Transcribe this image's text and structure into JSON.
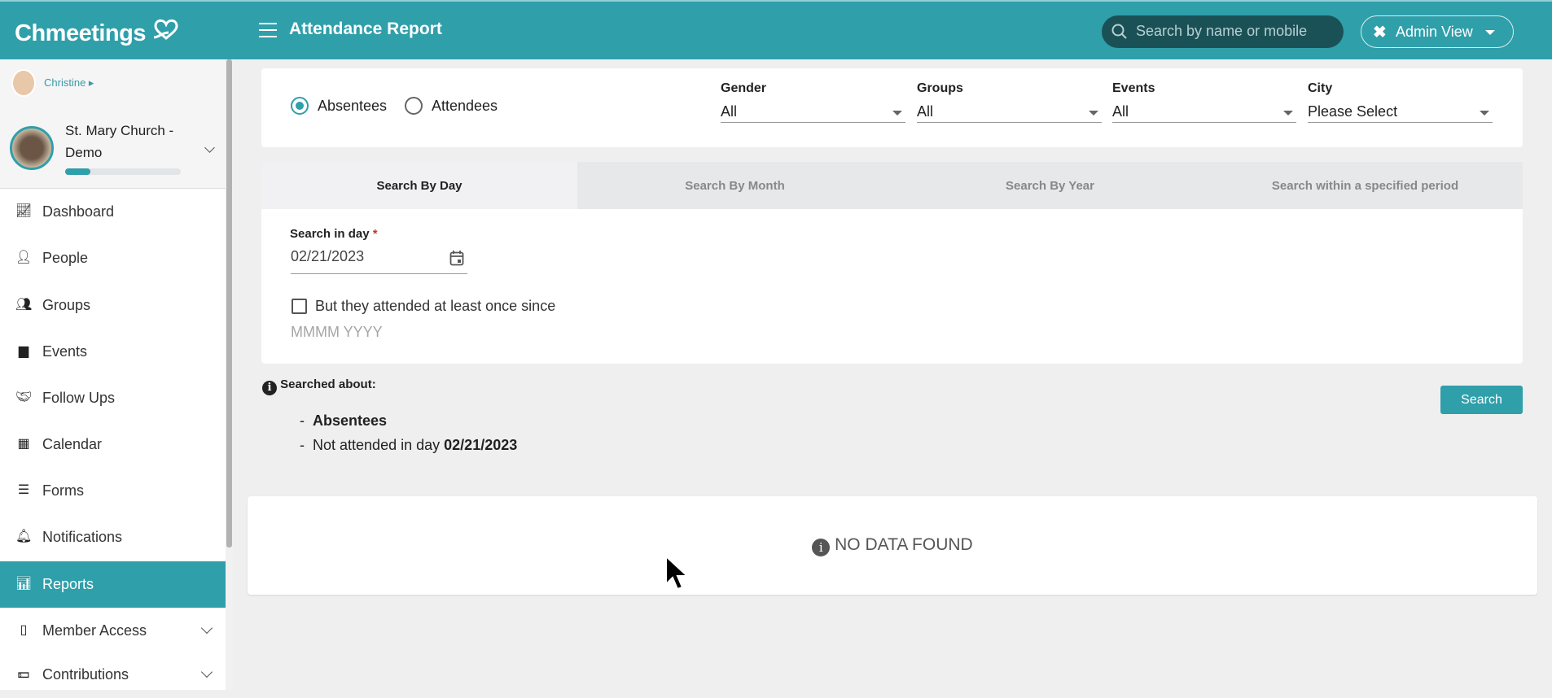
{
  "header": {
    "logo": "Chmeetings",
    "title": "Attendance Report",
    "search_placeholder": "Search by name or mobile",
    "admin_view": "Admin View"
  },
  "sidebar": {
    "user": "Christine",
    "church": "St. Mary Church -",
    "church2": "Demo",
    "progress": 0.22,
    "items": [
      {
        "label": "Dashboard"
      },
      {
        "label": "People"
      },
      {
        "label": "Groups"
      },
      {
        "label": "Events"
      },
      {
        "label": "Follow Ups"
      },
      {
        "label": "Calendar"
      },
      {
        "label": "Forms"
      },
      {
        "label": "Notifications"
      },
      {
        "label": "Reports"
      },
      {
        "label": "Member Access"
      },
      {
        "label": "Contributions"
      }
    ]
  },
  "filters": {
    "absentees": "Absentees",
    "attendees": "Attendees",
    "gender_label": "Gender",
    "gender": "All",
    "groups_label": "Groups",
    "groups": "All",
    "events_label": "Events",
    "events": "All",
    "city_label": "City",
    "city": "Please Select"
  },
  "tabs": [
    "Search By Day",
    "Search By Month",
    "Search By Year",
    "Search within a specified period"
  ],
  "form": {
    "day_label": "Search in day",
    "required": "*",
    "date": "02/21/2023",
    "checkbox_label": "But they attended at least once since",
    "month_placeholder": "MMMM YYYY"
  },
  "summary": {
    "title": "Searched about:",
    "line1": "Absentees",
    "line2_prefix": "Not attended in day",
    "line2_date": "02/21/2023",
    "dash": "-"
  },
  "search_button": "Search",
  "no_data": "NO DATA FOUND"
}
